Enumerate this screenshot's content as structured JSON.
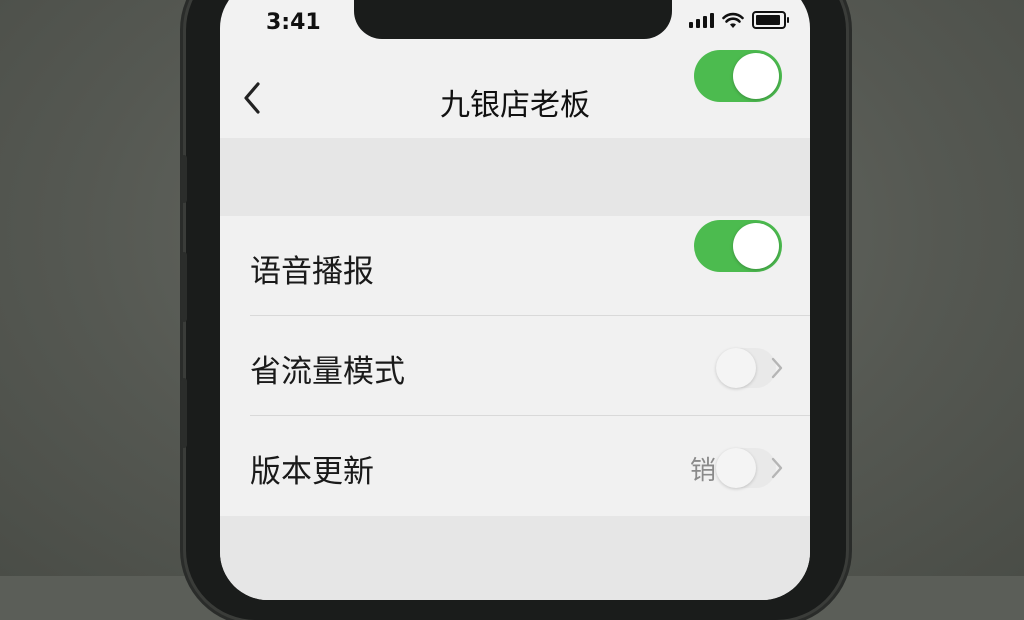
{
  "status_bar": {
    "time": "3:41",
    "icons": [
      "signal-icon",
      "wifi-icon",
      "battery-icon"
    ]
  },
  "nav": {
    "title": "九银店老板",
    "back_icon": "chevron-left-icon",
    "header_toggle": {
      "state": "on"
    }
  },
  "settings": [
    {
      "label": "语音播报",
      "control": "toggle",
      "state": "on"
    },
    {
      "label": "省流量模式",
      "control": "toggle",
      "state": "off",
      "chevron": "chevron-right-icon"
    },
    {
      "label": "版本更新",
      "control": "toggle",
      "state": "off",
      "peek_text": "销",
      "chevron": "chevron-right-icon"
    }
  ],
  "colors": {
    "toggle_on": "#4cbb4f",
    "background": "#f2f2f2",
    "band": "#e6e6e6"
  }
}
